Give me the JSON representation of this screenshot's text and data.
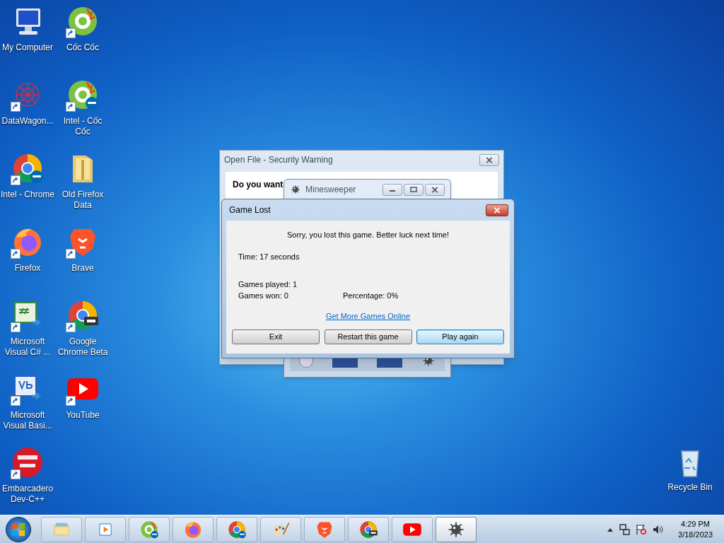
{
  "desktop_icons": [
    {
      "label": "My Computer",
      "kind": "computer",
      "shortcut": false
    },
    {
      "label": "DataWagon...",
      "kind": "datawagon",
      "shortcut": true
    },
    {
      "label": "Intel - Chrome",
      "kind": "chrome-intel",
      "shortcut": true
    },
    {
      "label": "Firefox",
      "kind": "firefox",
      "shortcut": true
    },
    {
      "label": "Microsoft Visual C# ...",
      "kind": "csharp",
      "shortcut": true
    },
    {
      "label": "Microsoft Visual Basi...",
      "kind": "vb",
      "shortcut": true
    },
    {
      "label": "Embarcadero Dev-C++",
      "kind": "devcpp",
      "shortcut": true
    },
    {
      "label": "Cốc Cốc",
      "kind": "coccoc",
      "shortcut": true
    },
    {
      "label": "Intel - Cốc Cốc",
      "kind": "coccoc-intel",
      "shortcut": true
    },
    {
      "label": "Old Firefox Data",
      "kind": "folder",
      "shortcut": false
    },
    {
      "label": "Brave",
      "kind": "brave",
      "shortcut": true
    },
    {
      "label": "Google Chrome Beta",
      "kind": "chromebeta",
      "shortcut": true
    },
    {
      "label": "YouTube",
      "kind": "youtube",
      "shortcut": true
    }
  ],
  "recycle_bin": {
    "label": "Recycle Bin"
  },
  "security_window": {
    "title": "Open File - Security Warning",
    "text": "Do you want"
  },
  "minesweeper_window": {
    "title": "Minesweeper"
  },
  "dialog": {
    "title": "Game Lost",
    "message": "Sorry, you lost this game. Better luck next time!",
    "time": "Time: 17 seconds",
    "games_played": "Games played: 1",
    "games_won": "Games won: 0",
    "percentage": "Percentage: 0%",
    "link": "Get More Games Online",
    "buttons": [
      {
        "label": "Exit",
        "default": false
      },
      {
        "label": "Restart this game",
        "default": false
      },
      {
        "label": "Play again",
        "default": true
      }
    ]
  },
  "taskbar": {
    "items": [
      {
        "kind": "explorer",
        "selected": false
      },
      {
        "kind": "media",
        "selected": false
      },
      {
        "kind": "coccoc-intel",
        "selected": false
      },
      {
        "kind": "firefox",
        "selected": false
      },
      {
        "kind": "chrome-intel",
        "selected": false
      },
      {
        "kind": "paint",
        "selected": false
      },
      {
        "kind": "brave",
        "selected": false
      },
      {
        "kind": "chromebeta",
        "selected": false
      },
      {
        "kind": "youtube",
        "selected": false
      },
      {
        "kind": "minesweeper",
        "selected": true
      }
    ],
    "time": "4:29 PM",
    "date": "3/18/2023"
  }
}
